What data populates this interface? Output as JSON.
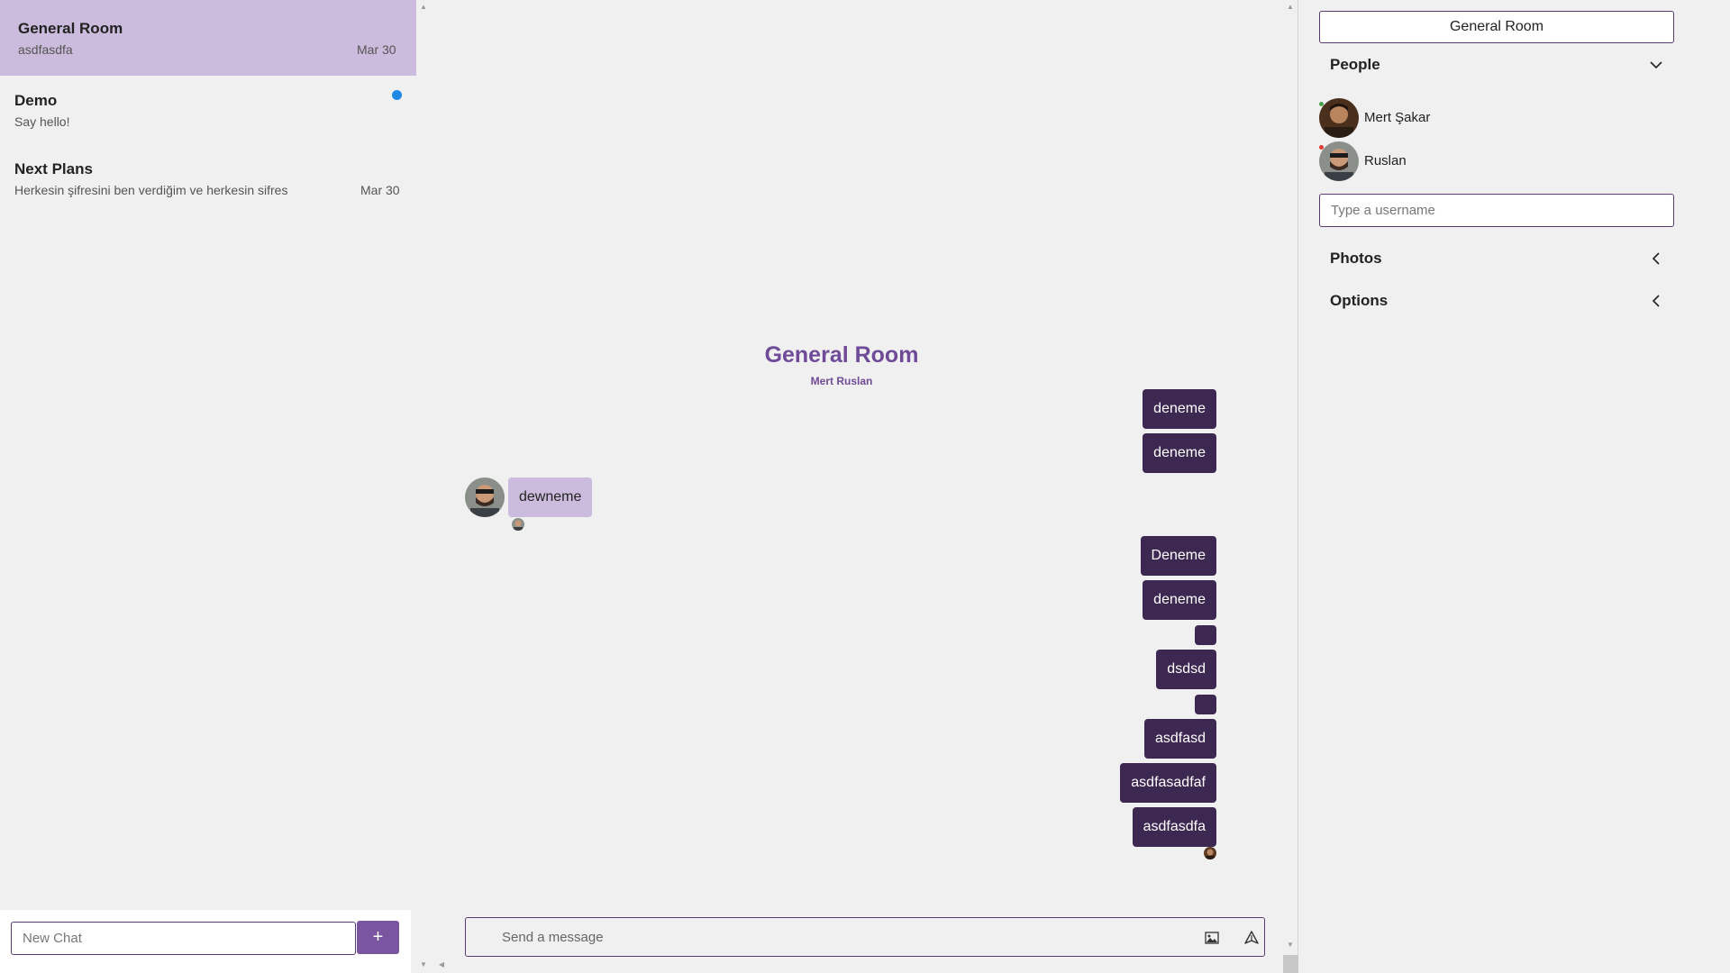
{
  "chats": [
    {
      "title": "General Room",
      "preview": "asdfasdfa",
      "date": "Mar 30",
      "active": true,
      "unread": false
    },
    {
      "title": "Demo",
      "preview": "Say hello!",
      "date": "",
      "active": false,
      "unread": true
    },
    {
      "title": "Next Plans",
      "preview": "Herkesin şifresini ben verdiğim ve herkesin sifres",
      "date": "Mar 30",
      "active": false,
      "unread": false
    }
  ],
  "new_chat": {
    "placeholder": "New Chat",
    "add_label": "+"
  },
  "room": {
    "title": "General Room",
    "members": "Mert Ruslan"
  },
  "messages": [
    {
      "text": "deneme",
      "from": "me"
    },
    {
      "text": "deneme",
      "from": "me"
    },
    {
      "text": "dewneme",
      "from": "other"
    },
    {
      "text": "Deneme",
      "from": "me"
    },
    {
      "text": "deneme",
      "from": "me"
    },
    {
      "text": "",
      "from": "me"
    },
    {
      "text": "dsdsd",
      "from": "me"
    },
    {
      "text": "",
      "from": "me"
    },
    {
      "text": "asdfasd",
      "from": "me"
    },
    {
      "text": "asdfasadfaf",
      "from": "me"
    },
    {
      "text": "asdfasdfa",
      "from": "me"
    }
  ],
  "composer": {
    "placeholder": "Send a message",
    "image_icon": "image-icon",
    "send_icon": "send-icon"
  },
  "details": {
    "room_name": "General Room",
    "people_label": "People",
    "people": [
      {
        "name": "Mert Şakar",
        "status_color": "#43a047"
      },
      {
        "name": "Ruslan",
        "status_color": "#e53935"
      }
    ],
    "username_placeholder": "Type a username",
    "photos_label": "Photos",
    "options_label": "Options"
  },
  "colors": {
    "accent": "#6f4a98",
    "bubble_mine": "#3d2852",
    "bubble_theirs": "#cbbbdc",
    "active_chat": "#cbbbdc",
    "unread": "#1e88e5"
  }
}
